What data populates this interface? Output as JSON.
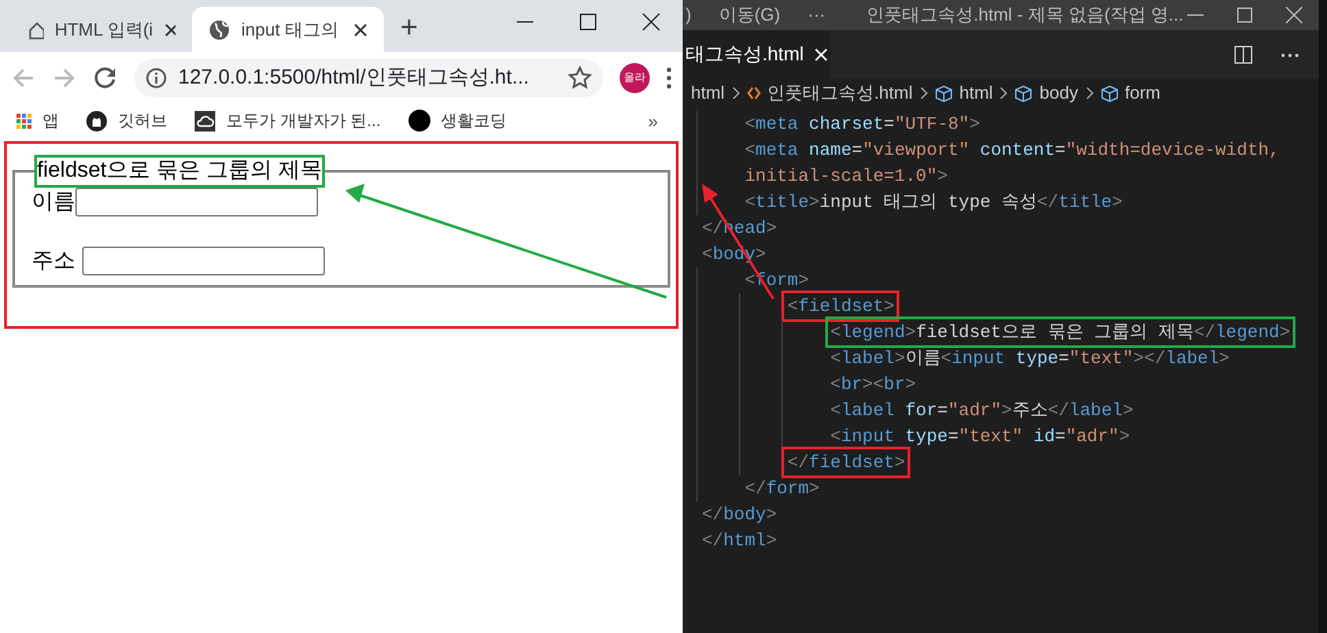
{
  "browser": {
    "tabs": [
      {
        "title": "HTML 입력(i",
        "selected": false
      },
      {
        "title": "input 태그의",
        "selected": true
      }
    ],
    "new_tab": "+",
    "address": "127.0.0.1:5500/html/인풋태그속성.ht...",
    "profile": "올라",
    "bookmarks": [
      {
        "label": "앱"
      },
      {
        "label": "깃허브"
      },
      {
        "label": "모두가 개발자가 된..."
      },
      {
        "label": "생활코딩"
      }
    ],
    "more_bookmarks": "»",
    "page": {
      "legend": "fieldset으로 묶은 그룹의 제목",
      "fields": [
        {
          "label": "이름"
        },
        {
          "label": "주소"
        }
      ]
    }
  },
  "editor": {
    "menu": [
      ")",
      "이동(G)",
      "···"
    ],
    "title": "인풋태그속성.html - 제목 없음(작업 영...",
    "tab": "태그속성.html",
    "breadcrumb": [
      "html",
      "인풋태그속성.html",
      "html",
      "body",
      "form"
    ],
    "lines": [
      {
        "tokens": [
          {
            "kind": "punct",
            "text": "    <"
          },
          {
            "kind": "tag",
            "text": "meta"
          },
          {
            "kind": "attr",
            "text": " charset"
          },
          {
            "kind": "plain",
            "text": "="
          },
          {
            "kind": "string",
            "text": "\"UTF-8\""
          },
          {
            "kind": "punct",
            "text": ">"
          }
        ]
      },
      {
        "tokens": [
          {
            "kind": "punct",
            "text": "    <"
          },
          {
            "kind": "tag",
            "text": "meta"
          },
          {
            "kind": "attr",
            "text": " name"
          },
          {
            "kind": "plain",
            "text": "="
          },
          {
            "kind": "string",
            "text": "\"viewport\""
          },
          {
            "kind": "attr",
            "text": " content"
          },
          {
            "kind": "plain",
            "text": "="
          },
          {
            "kind": "string",
            "text": "\"width=device-width,"
          }
        ]
      },
      {
        "tokens": [
          {
            "kind": "string",
            "text": "    initial-scale=1.0\""
          },
          {
            "kind": "punct",
            "text": ">"
          }
        ]
      },
      {
        "tokens": [
          {
            "kind": "punct",
            "text": "    <"
          },
          {
            "kind": "tag",
            "text": "title"
          },
          {
            "kind": "punct",
            "text": ">"
          },
          {
            "kind": "plain",
            "text": "input 태그의 type 속성"
          },
          {
            "kind": "punct",
            "text": "</"
          },
          {
            "kind": "tag",
            "text": "title"
          },
          {
            "kind": "punct",
            "text": ">"
          }
        ]
      },
      {
        "tokens": [
          {
            "kind": "punct",
            "text": "</"
          },
          {
            "kind": "tag",
            "text": "head"
          },
          {
            "kind": "punct",
            "text": ">"
          }
        ]
      },
      {
        "tokens": [
          {
            "kind": "punct",
            "text": "<"
          },
          {
            "kind": "tag",
            "text": "body"
          },
          {
            "kind": "punct",
            "text": ">"
          }
        ]
      },
      {
        "tokens": [
          {
            "kind": "punct",
            "text": "    <"
          },
          {
            "kind": "tag",
            "text": "form"
          },
          {
            "kind": "punct",
            "text": ">"
          }
        ]
      },
      {
        "color": "#e8212b",
        "tokens": [
          {
            "kind": "punct",
            "text": "        <"
          },
          {
            "kind": "tag",
            "text": "fieldset"
          },
          {
            "kind": "punct",
            "text": ">"
          }
        ]
      },
      {
        "color": "#22aa44",
        "tokens": [
          {
            "kind": "punct",
            "text": "            <"
          },
          {
            "kind": "tag",
            "text": "legend"
          },
          {
            "kind": "punct",
            "text": ">"
          },
          {
            "kind": "plain",
            "text": "fieldset으로 묶은 그룹의 제목"
          },
          {
            "kind": "punct",
            "text": "</"
          },
          {
            "kind": "tag",
            "text": "legend"
          },
          {
            "kind": "punct",
            "text": ">"
          }
        ]
      },
      {
        "tokens": [
          {
            "kind": "punct",
            "text": "            <"
          },
          {
            "kind": "tag",
            "text": "label"
          },
          {
            "kind": "punct",
            "text": ">"
          },
          {
            "kind": "plain",
            "text": "이름"
          },
          {
            "kind": "punct",
            "text": "<"
          },
          {
            "kind": "tag",
            "text": "input"
          },
          {
            "kind": "attr",
            "text": " type"
          },
          {
            "kind": "plain",
            "text": "="
          },
          {
            "kind": "string",
            "text": "\"text\""
          },
          {
            "kind": "punct",
            "text": "></"
          },
          {
            "kind": "tag",
            "text": "label"
          },
          {
            "kind": "punct",
            "text": ">"
          }
        ]
      },
      {
        "tokens": [
          {
            "kind": "punct",
            "text": "            <"
          },
          {
            "kind": "tag",
            "text": "br"
          },
          {
            "kind": "punct",
            "text": "><"
          },
          {
            "kind": "tag",
            "text": "br"
          },
          {
            "kind": "punct",
            "text": ">"
          }
        ]
      },
      {
        "tokens": [
          {
            "kind": "punct",
            "text": "            <"
          },
          {
            "kind": "tag",
            "text": "label"
          },
          {
            "kind": "attr",
            "text": " for"
          },
          {
            "kind": "plain",
            "text": "="
          },
          {
            "kind": "string",
            "text": "\"adr\""
          },
          {
            "kind": "punct",
            "text": ">"
          },
          {
            "kind": "plain",
            "text": "주소"
          },
          {
            "kind": "punct",
            "text": "</"
          },
          {
            "kind": "tag",
            "text": "label"
          },
          {
            "kind": "punct",
            "text": ">"
          }
        ]
      },
      {
        "tokens": [
          {
            "kind": "punct",
            "text": "            <"
          },
          {
            "kind": "tag",
            "text": "input"
          },
          {
            "kind": "attr",
            "text": " type"
          },
          {
            "kind": "plain",
            "text": "="
          },
          {
            "kind": "string",
            "text": "\"text\""
          },
          {
            "kind": "attr",
            "text": " id"
          },
          {
            "kind": "plain",
            "text": "="
          },
          {
            "kind": "string",
            "text": "\"adr\""
          },
          {
            "kind": "punct",
            "text": ">"
          }
        ]
      },
      {
        "color": "#e8212b",
        "tokens": [
          {
            "kind": "punct",
            "text": "        </"
          },
          {
            "kind": "tag",
            "text": "fieldset"
          },
          {
            "kind": "punct",
            "text": ">"
          }
        ]
      },
      {
        "tokens": [
          {
            "kind": "punct",
            "text": "    </"
          },
          {
            "kind": "tag",
            "text": "form"
          },
          {
            "kind": "punct",
            "text": ">"
          }
        ]
      },
      {
        "tokens": [
          {
            "kind": "punct",
            "text": "</"
          },
          {
            "kind": "tag",
            "text": "body"
          },
          {
            "kind": "punct",
            "text": ">"
          }
        ]
      },
      {
        "tokens": [
          {
            "kind": "punct",
            "text": "</"
          },
          {
            "kind": "tag",
            "text": "html"
          },
          {
            "kind": "punct",
            "text": ">"
          }
        ]
      }
    ]
  }
}
